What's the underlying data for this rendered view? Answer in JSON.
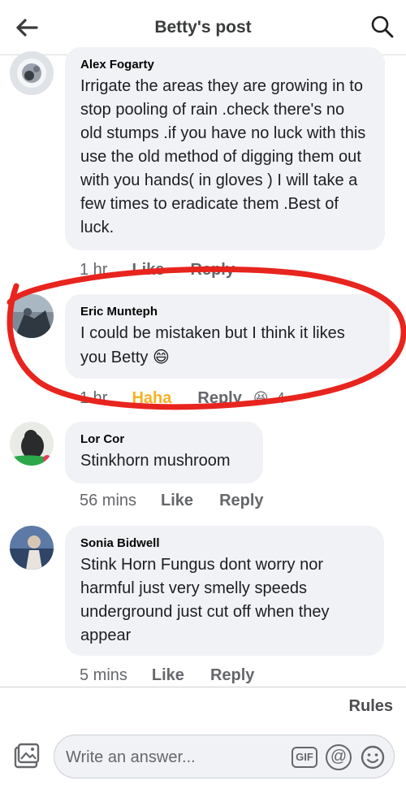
{
  "header": {
    "title": "Betty's post",
    "back_icon": "arrow-left-icon",
    "search_icon": "search-icon"
  },
  "comments": [
    {
      "author": "Alex Fogarty",
      "text": "Irrigate the areas they are growing in to stop pooling of rain .check there's no old stumps .if you have no luck with this use the old method of digging them out with you hands( in gloves ) I will take  a few times to eradicate them .Best of luck.",
      "time": "1 hr",
      "like_label": "Like",
      "reply_label": "Reply"
    },
    {
      "author": "Eric Munteph",
      "text": "I could be mistaken but I think it likes you Betty",
      "emoji": "😄",
      "time": "1 hr",
      "reaction_label": "Haha",
      "reply_label": "Reply",
      "reaction_emoji": "😆",
      "reaction_count": "4"
    },
    {
      "author": "Lor Cor",
      "text": "Stinkhorn mushroom",
      "time": "56 mins",
      "like_label": "Like",
      "reply_label": "Reply"
    },
    {
      "author": "Sonia Bidwell",
      "text": "Stink Horn  Fungus  dont worry nor harmful just very smelly  speeds underground   just cut off when they appear",
      "time": "5 mins",
      "like_label": "Like",
      "reply_label": "Reply"
    }
  ],
  "footer": {
    "rules_label": "Rules",
    "composer_placeholder": "Write an answer...",
    "gif_label": "GIF",
    "at_label": "@"
  },
  "colors": {
    "bubble": "#f0f2f5",
    "haha": "#f7b125",
    "annotation": "#e8241e",
    "muted_text": "#65676b"
  }
}
